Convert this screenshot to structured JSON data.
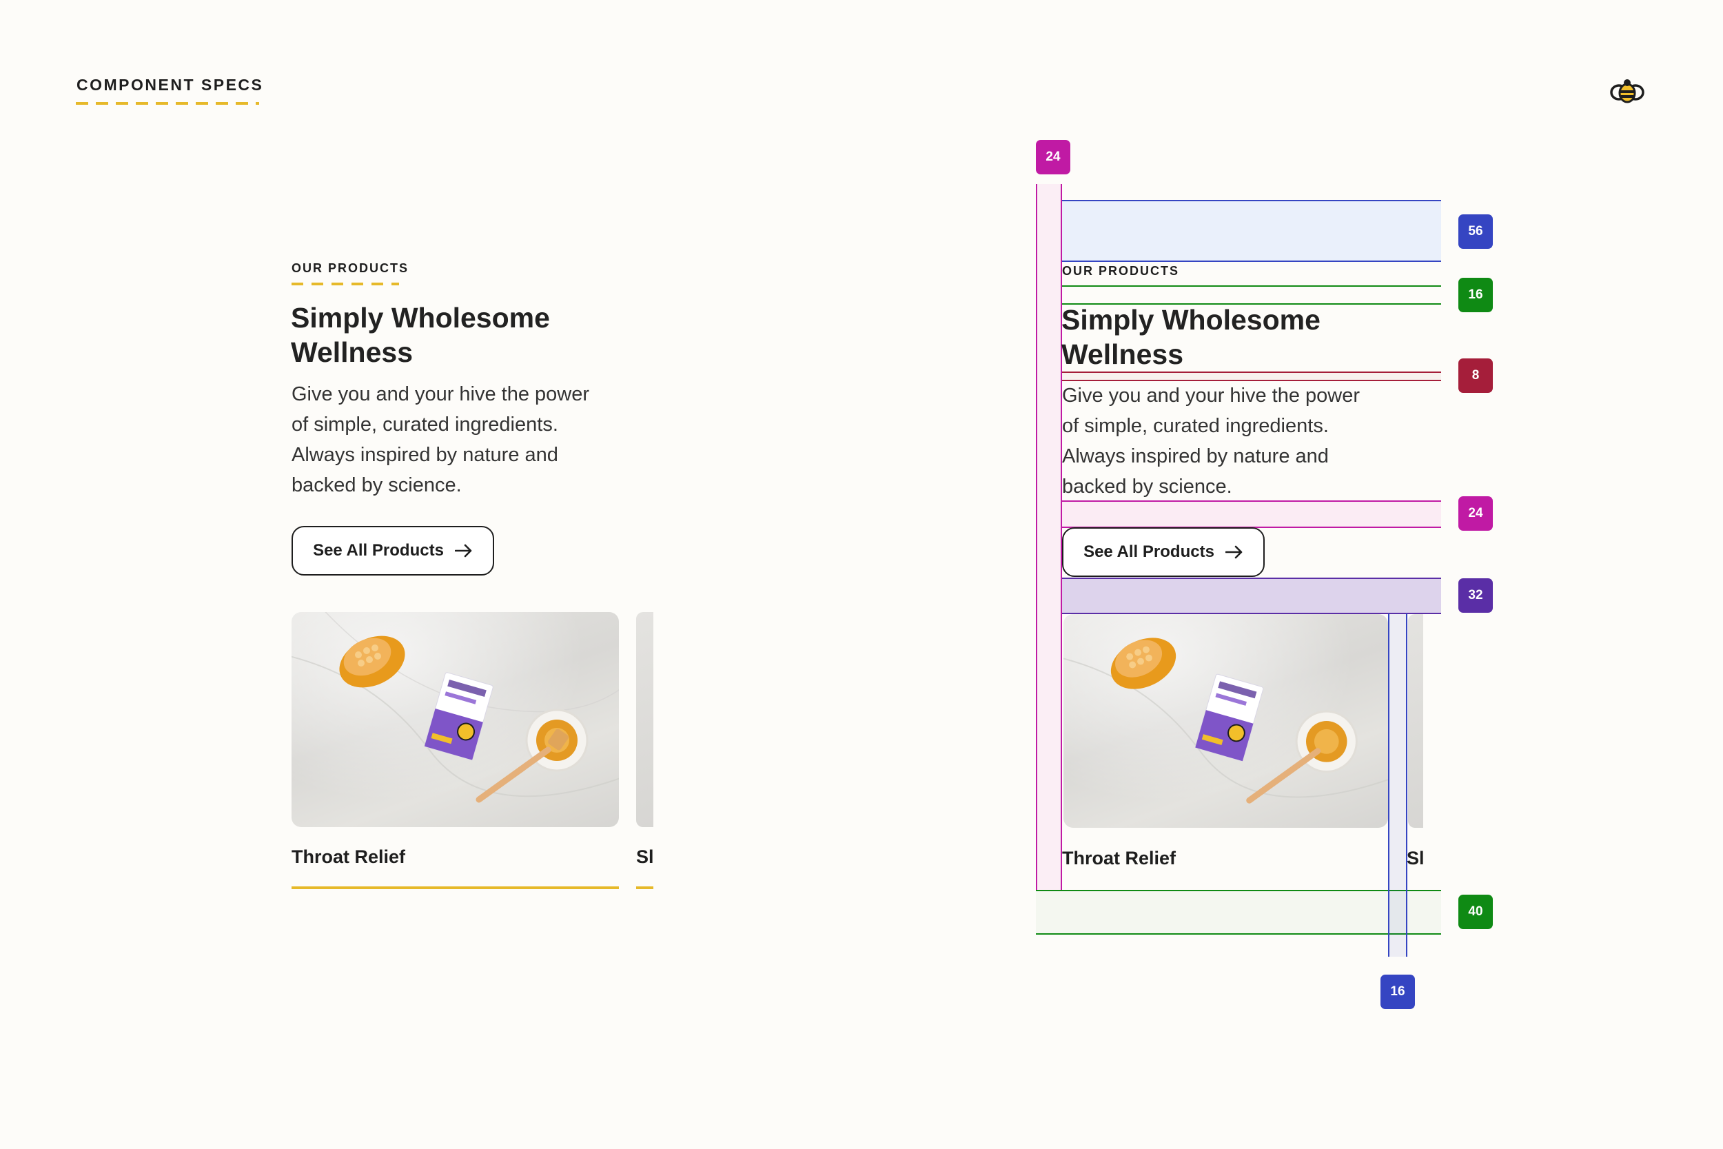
{
  "header": {
    "title": "COMPONENT SPECS",
    "logo_icon": "bee-logo-icon"
  },
  "colors": {
    "background": "#fdfcf9",
    "accent_gold": "#e6b92a",
    "text": "#1e1e1e",
    "spec_magenta": "#c01aa4",
    "spec_blue": "#3545c2",
    "spec_green": "#0f8a14",
    "spec_crimson": "#a51e3a",
    "spec_purple": "#5a2ea6"
  },
  "product_section": {
    "eyebrow": "OUR PRODUCTS",
    "title_line1": "Simply Wholesome",
    "title_line2": "Wellness",
    "body_line1": "Give you and your hive the power",
    "body_line2": "of simple, curated ingredients.",
    "body_line3": "Always inspired by nature and",
    "body_line4": "backed by science.",
    "cta_label": "See All Products",
    "cta_icon": "arrow-right-icon",
    "card": {
      "label": "Throat Relief",
      "image_subject": "honeycomb, cough syrup box and honey bowl with dipper"
    },
    "peek_card": {
      "label": "Sl"
    }
  },
  "spec_annotations": {
    "left_padding": "24",
    "top_padding": "56",
    "eyebrow_gap": "16",
    "title_gap": "8",
    "body_gap": "24",
    "button_gap": "32",
    "bottom_padding": "40",
    "card_gap": "16"
  }
}
